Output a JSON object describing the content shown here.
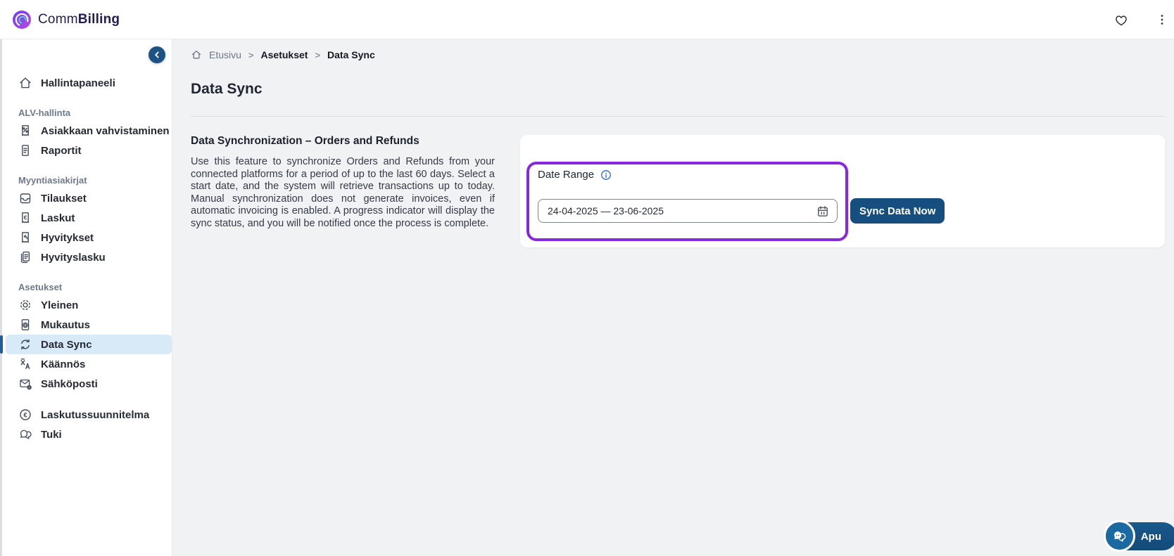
{
  "colors": {
    "accent_purple": "#8728e0",
    "primary_blue": "#174e80",
    "active_item_bg": "#d8e9f8",
    "info_blue": "#2567d8",
    "page_bg": "#f1f2f4"
  },
  "topbar": {
    "brand_prefix": "Comm",
    "brand_suffix": "Billing"
  },
  "sidebar": {
    "sections": [
      {
        "items": [
          {
            "label": "Hallintapaneeli",
            "icon": "home-icon"
          }
        ]
      },
      {
        "header": "ALV-hallinta",
        "items": [
          {
            "label": "Asiakkaan vahvistaminen",
            "icon": "receipt-percent-icon"
          },
          {
            "label": "Raportit",
            "icon": "document-icon"
          }
        ]
      },
      {
        "header": "Myyntiasiakirjat",
        "items": [
          {
            "label": "Tilaukset",
            "icon": "inbox-icon"
          },
          {
            "label": "Laskut",
            "icon": "invoice-euro-icon"
          },
          {
            "label": "Hyvitykset",
            "icon": "receipt-refund-icon"
          },
          {
            "label": "Hyvityslasku",
            "icon": "copy-document-icon"
          }
        ]
      },
      {
        "header": "Asetukset",
        "items": [
          {
            "label": "Yleinen",
            "icon": "gear-icon"
          },
          {
            "label": "Mukautus",
            "icon": "document-gear-icon"
          },
          {
            "label": "Data Sync",
            "icon": "sync-icon",
            "active": true
          },
          {
            "label": "Käännös",
            "icon": "translate-icon"
          },
          {
            "label": "Sähköposti",
            "icon": "mail-gear-icon"
          }
        ]
      },
      {
        "items": [
          {
            "label": "Laskutussuunnitelma",
            "icon": "euro-circle-icon"
          },
          {
            "label": "Tuki",
            "icon": "chat-icon"
          }
        ]
      }
    ]
  },
  "breadcrumb": {
    "separator": ">",
    "home": "Etusivu",
    "level2": "Asetukset",
    "level3": "Data Sync"
  },
  "page": {
    "title": "Data Sync"
  },
  "content": {
    "section_title": "Data Synchronization – Orders and Refunds",
    "description": "Use this feature to synchronize Orders and Refunds from your connected platforms for a period of up to the last 60 days. Select a start date, and the system will retrieve transactions up to today. Manual synchronization does not generate invoices, even if automatic invoicing is enabled. A progress indicator will display the sync status, and you will be notified once the process is complete.",
    "date_range": {
      "label": "Date Range",
      "value": "24-04-2025 — 23-06-2025"
    },
    "sync_button_label": "Sync Data Now"
  },
  "help_button": {
    "label": "Apu"
  }
}
